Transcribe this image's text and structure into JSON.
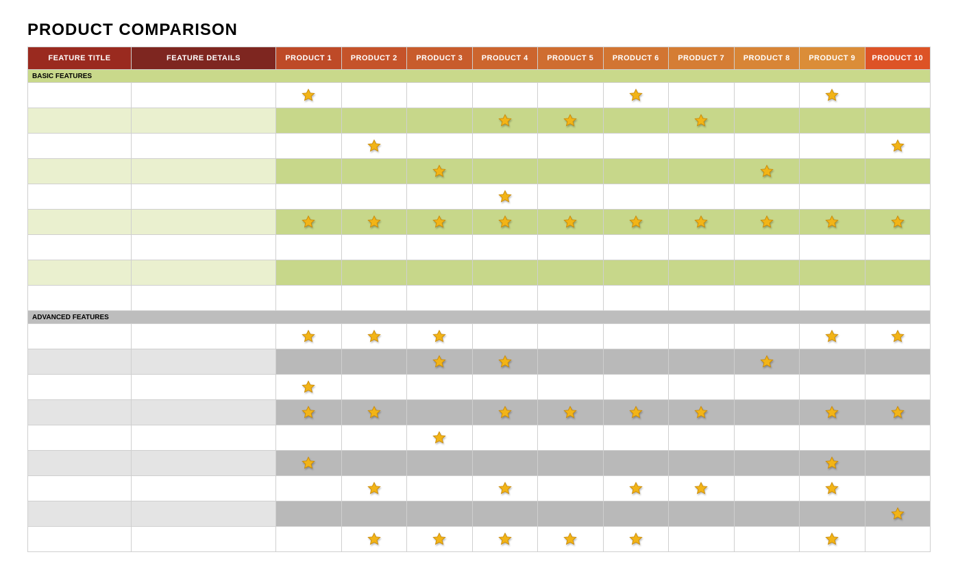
{
  "title": "PRODUCT COMPARISON",
  "headers": {
    "feature_title": "FEATURE TITLE",
    "feature_details": "FEATURE DETAILS",
    "products": [
      "PRODUCT 1",
      "PRODUCT 2",
      "PRODUCT 3",
      "PRODUCT 4",
      "PRODUCT 5",
      "PRODUCT 6",
      "PRODUCT 7",
      "PRODUCT 8",
      "PRODUCT 9",
      "PRODUCT 10"
    ]
  },
  "sections": [
    {
      "name": "BASIC FEATURES",
      "kind": "basic",
      "rows": [
        {
          "title": "",
          "details": "",
          "cells": [
            true,
            false,
            false,
            false,
            false,
            true,
            false,
            false,
            true,
            false
          ],
          "highlight": []
        },
        {
          "title": "",
          "details": "",
          "cells": [
            false,
            false,
            false,
            true,
            true,
            false,
            true,
            false,
            false,
            false
          ],
          "highlight": [
            0,
            1,
            2,
            3,
            4,
            5,
            6,
            7,
            8,
            9
          ]
        },
        {
          "title": "",
          "details": "",
          "cells": [
            false,
            true,
            false,
            false,
            false,
            false,
            false,
            false,
            false,
            true
          ],
          "highlight": []
        },
        {
          "title": "",
          "details": "",
          "cells": [
            false,
            false,
            true,
            false,
            false,
            false,
            false,
            true,
            false,
            false
          ],
          "highlight": [
            0,
            1,
            2,
            3,
            4,
            5,
            6,
            7,
            8,
            9
          ]
        },
        {
          "title": "",
          "details": "",
          "cells": [
            false,
            false,
            false,
            true,
            false,
            false,
            false,
            false,
            false,
            false
          ],
          "highlight": []
        },
        {
          "title": "",
          "details": "",
          "cells": [
            true,
            true,
            true,
            true,
            true,
            true,
            true,
            true,
            true,
            true
          ],
          "highlight": [
            0,
            1,
            2,
            3,
            4,
            5,
            6,
            7,
            8,
            9
          ]
        },
        {
          "title": "",
          "details": "",
          "cells": [
            false,
            false,
            false,
            false,
            false,
            false,
            false,
            false,
            false,
            false
          ],
          "highlight": []
        },
        {
          "title": "",
          "details": "",
          "cells": [
            false,
            false,
            false,
            false,
            false,
            false,
            false,
            false,
            false,
            false
          ],
          "highlight": [
            0,
            1,
            2,
            3,
            4,
            5,
            6,
            7,
            8,
            9
          ]
        },
        {
          "title": "",
          "details": "",
          "cells": [
            false,
            false,
            false,
            false,
            false,
            false,
            false,
            false,
            false,
            false
          ],
          "highlight": []
        }
      ]
    },
    {
      "name": "ADVANCED FEATURES",
      "kind": "adv",
      "rows": [
        {
          "title": "",
          "details": "",
          "cells": [
            true,
            true,
            true,
            false,
            false,
            false,
            false,
            false,
            true,
            true
          ],
          "highlight": []
        },
        {
          "title": "",
          "details": "",
          "cells": [
            false,
            false,
            true,
            true,
            false,
            false,
            false,
            true,
            false,
            false
          ],
          "highlight": [
            0,
            1,
            2,
            3,
            4,
            5,
            6,
            7,
            8,
            9
          ]
        },
        {
          "title": "",
          "details": "",
          "cells": [
            true,
            false,
            false,
            false,
            false,
            false,
            false,
            false,
            false,
            false
          ],
          "highlight": []
        },
        {
          "title": "",
          "details": "",
          "cells": [
            true,
            true,
            false,
            true,
            true,
            true,
            true,
            false,
            true,
            true
          ],
          "highlight": [
            0,
            1,
            2,
            3,
            4,
            5,
            6,
            7,
            8,
            9
          ]
        },
        {
          "title": "",
          "details": "",
          "cells": [
            false,
            false,
            true,
            false,
            false,
            false,
            false,
            false,
            false,
            false
          ],
          "highlight": []
        },
        {
          "title": "",
          "details": "",
          "cells": [
            true,
            false,
            false,
            false,
            false,
            false,
            false,
            false,
            true,
            false
          ],
          "highlight": [
            0,
            1,
            2,
            3,
            4,
            5,
            6,
            7,
            8,
            9
          ]
        },
        {
          "title": "",
          "details": "",
          "cells": [
            false,
            true,
            false,
            true,
            false,
            true,
            true,
            false,
            true,
            false
          ],
          "highlight": []
        },
        {
          "title": "",
          "details": "",
          "cells": [
            false,
            false,
            false,
            false,
            false,
            false,
            false,
            false,
            false,
            true
          ],
          "highlight": [
            0,
            1,
            2,
            3,
            4,
            5,
            6,
            7,
            8,
            9
          ]
        },
        {
          "title": "",
          "details": "",
          "cells": [
            false,
            true,
            true,
            true,
            true,
            true,
            false,
            false,
            true,
            false
          ],
          "highlight": []
        }
      ]
    }
  ]
}
